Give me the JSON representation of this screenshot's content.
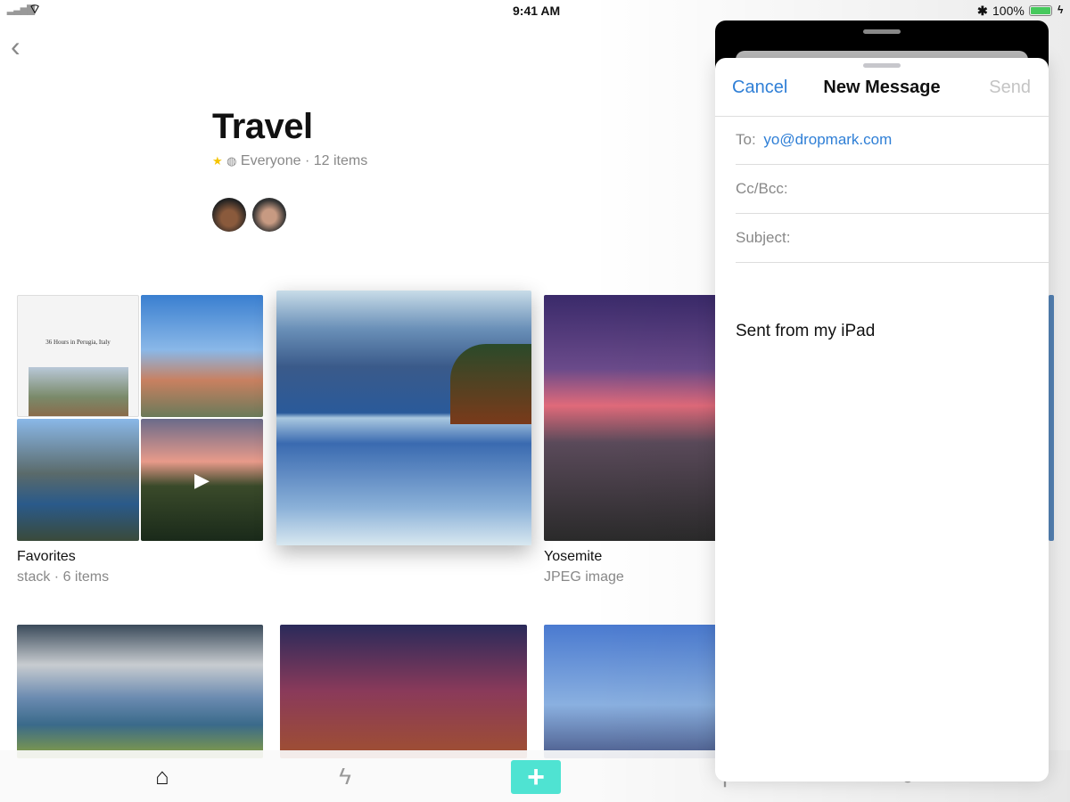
{
  "status": {
    "time": "9:41 AM",
    "battery": "100%"
  },
  "collection": {
    "title": "Travel",
    "visibility": "Everyone",
    "count": "12 items",
    "separator": "·"
  },
  "items": [
    {
      "name": "Favorites",
      "meta": "stack · 6 items"
    },
    {
      "name": "",
      "meta": ""
    },
    {
      "name": "Yosemite",
      "meta": "JPEG image"
    }
  ],
  "stack_thumb_text": "36 Hours in Perugia, Italy",
  "tabbar": {
    "items": [
      "home-icon",
      "lightning-icon",
      "plus-icon",
      "search-icon",
      "profile-icon"
    ],
    "plus": "+",
    "accent": "#4fe3d2"
  },
  "mail": {
    "cancel": "Cancel",
    "title": "New Message",
    "send": "Send",
    "to_label": "To:",
    "to_value": "yo@dropmark.com",
    "cc_label": "Cc/Bcc:",
    "subject_label": "Subject:",
    "body": "Sent from my iPad",
    "accent": "#2f7fd6"
  }
}
